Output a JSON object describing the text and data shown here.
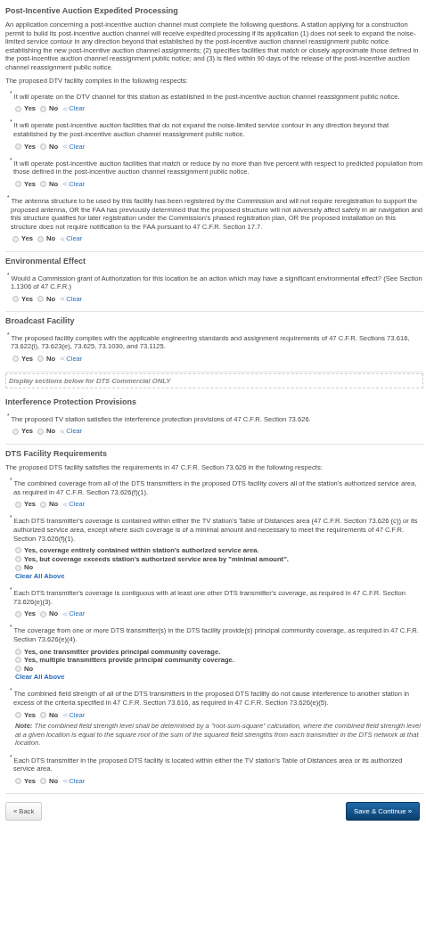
{
  "sections": [
    {
      "kind": "form",
      "title": "Post-Incentive Auction Expedited Processing",
      "blocks": [
        {
          "kind": "paragraph",
          "text": "An application concerning a post-incentive auction channel must complete the following questions. A station applying for a construction permit to build its post-incentive auction channel will receive expedited processing if its application (1) does not seek to expand the noise-limited service contour in any direction beyond that established by the post-incentive auction channel reassignment public notice establishing the new post-incentive auction channel assignments; (2) specifies facilities that match or closely approximate those defined in the post-incentive auction channel reassignment public notice; and (3) is filed within 90 days of the release of the post-incentive auction channel reassignment public notice."
        },
        {
          "kind": "group",
          "intro": "The proposed DTV facility complies in the following respects:",
          "questions": [
            {
              "text": "$^{*}$ It will operate on the DTV channel for this station as established in the post-incentive auction channel reassignment public notice.",
              "answer": {
                "kind": "yesno",
                "options": [
                  {
                    "label": "Yes",
                    "selected": false
                  },
                  {
                    "label": "No",
                    "selected": false
                  }
                ],
                "clear": "Clear"
              }
            },
            {
              "text": "$^{*}$ It will operate post-incentive auction facilities that do not expand the noise-limited service contour in any direction beyond that established by the post-incentive auction channel reassignment public notice.",
              "answer": {
                "kind": "yesno",
                "options": [
                  {
                    "label": "Yes",
                    "selected": false
                  },
                  {
                    "label": "No",
                    "selected": false
                  }
                ],
                "clear": "Clear"
              }
            },
            {
              "text": "$^{*}$ It will operate post-incentive auction facilities that match or reduce by no more than five percent with respect to predicted population from those defined in the post-incentive auction channel reassignment public notice.",
              "answer": {
                "kind": "yesno",
                "options": [
                  {
                    "label": "Yes",
                    "selected": false
                  },
                  {
                    "label": "No",
                    "selected": false
                  }
                ],
                "clear": "Clear"
              }
            }
          ]
        },
        {
          "kind": "question",
          "text": "$^{*}$ The antenna structure to be used by this facility has been registered by the Commission and will not require reregistration to support the proposed antenna, OR the FAA has previously determined that the proposed structure will not adversely affect safety in air navigation and this structure qualifies for later registration under the Commission's phased registration plan, OR the proposed installation on this structure does not require notification to the FAA pursuant to 47 C.F.R. Section 17.7.",
          "answer": {
            "kind": "yesno",
            "options": [
              {
                "label": "Yes",
                "selected": false
              },
              {
                "label": "No",
                "selected": false
              }
            ],
            "clear": "Clear"
          }
        }
      ]
    },
    {
      "kind": "form",
      "title": "Environmental Effect",
      "blocks": [
        {
          "kind": "question",
          "text": "$^{*}$ Would a Commission grant of Authorization for this location be an action which may have a significant environmental effect? (See Section 1.1306 of 47 C.F.R.)",
          "answer": {
            "kind": "yesno",
            "options": [
              {
                "label": "Yes",
                "selected": false
              },
              {
                "label": "No",
                "selected": false
              }
            ],
            "clear": "Clear"
          }
        }
      ]
    },
    {
      "kind": "form",
      "title": "Broadcast Facility",
      "blocks": [
        {
          "kind": "question",
          "text": "$^{*}$ The proposed facility complies with the applicable engineering standards and assignment requirements of 47 C.F.R. Sections 73.616, 73.622(i), 73.623(e), 73.625, 73.1030, and 73.1125.",
          "answer": {
            "kind": "yesno",
            "options": [
              {
                "label": "Yes",
                "selected": false
              },
              {
                "label": "No",
                "selected": false
              }
            ],
            "clear": "Clear"
          }
        }
      ]
    },
    {
      "kind": "notice",
      "text": "Display sections below for DTS Commercial ONLY"
    },
    {
      "kind": "form",
      "title": "Interference Protection Provisions",
      "blocks": [
        {
          "kind": "question",
          "text": "$^{*}$ The proposed TV station satisfies the interference protection provisions of 47 C.F.R. Section 73.626.",
          "answer": {
            "kind": "yesno",
            "options": [
              {
                "label": "Yes",
                "selected": false
              },
              {
                "label": "No",
                "selected": false
              }
            ],
            "clear": "Clear"
          }
        }
      ]
    },
    {
      "kind": "form",
      "title": "DTS Facility Requirements",
      "blocks": [
        {
          "kind": "group",
          "intro": "The proposed DTS facility satisfies the requirements in 47 C.F.R. Section 73.626 in the following respects:",
          "questions": [
            {
              "text": "$^{*}$ The combined coverage from all of the DTS transmitters in the proposed DTS facility covers all of the station's authorized service area, as required in 47 C.F.R. Section 73.626(f)(1).",
              "answer": {
                "kind": "yesno",
                "options": [
                  {
                    "label": "Yes",
                    "selected": false
                  },
                  {
                    "label": "No",
                    "selected": false
                  }
                ],
                "clear": "Clear"
              }
            },
            {
              "text": "$^{*}$ Each DTS transmitter's coverage is contained within either the TV station's Table of Distances area (47 C.F.R. Section 73.626 (c)) or its authorized service area, except where such coverage is of a minimal amount and necessary to meet the requirements of 47 C.F.R. Section 73.626(f)(1).",
              "answer": {
                "kind": "choice",
                "options": [
                  {
                    "label": "Yes, coverage entirely contained within station's authorized service area.",
                    "selected": false
                  },
                  {
                    "label": "Yes, but coverage exceeds station's authorized service area by \"minimal amount\".",
                    "selected": false
                  },
                  {
                    "label": "No",
                    "selected": false
                  }
                ],
                "clear": "Clear All Above"
              }
            },
            {
              "text": "$^{*}$ Each DTS transmitter's coverage is contiguous with at least one other DTS transmitter's coverage, as required in 47 C.F.R. Section 73.626(e)(3).",
              "answer": {
                "kind": "yesno",
                "options": [
                  {
                    "label": "Yes",
                    "selected": false
                  },
                  {
                    "label": "No",
                    "selected": false
                  }
                ],
                "clear": "Clear"
              }
            },
            {
              "text": "$^{*}$ The coverage from one or more DTS transmitter(s) in the DTS facility provide(s) principal community coverage, as required in 47 C.F.R. Section 73.626(e)(4).",
              "answer": {
                "kind": "choice",
                "options": [
                  {
                    "label": "Yes, one transmitter provides principal community coverage.",
                    "selected": false
                  },
                  {
                    "label": "Yes, multiple transmitters provide principal community coverage.",
                    "selected": false
                  },
                  {
                    "label": "No",
                    "selected": false
                  }
                ],
                "clear": "Clear All Above"
              }
            },
            {
              "text": "$^{*}$ The combined field strength of all of the DTS transmitters in the proposed DTS facility do not cause interference to another station in excess of the criteria specified in 47 C.F.R. Section 73.616, as required in 47 C.F.R. Section 73.626(e)(5).",
              "answer": {
                "kind": "yesno",
                "options": [
                  {
                    "label": "Yes",
                    "selected": false
                  },
                  {
                    "label": "No",
                    "selected": false
                  }
                ],
                "clear": "Clear"
              },
              "note": "**Note:** The combined field strength level shall be determined by a \"root-sum-square\" calculation, where the combined field strength level at a given location is equal to the square root of the sum of the squared field strengths from each transmitter in the DTS network at that location."
            },
            {
              "text": "$^{*}$ Each DTS transmitter in the proposed DTS facility is located within either the TV station's Table of Distances area or its authorized service area.",
              "answer": {
                "kind": "yesno",
                "options": [
                  {
                    "label": "Yes",
                    "selected": false
                  },
                  {
                    "label": "No",
                    "selected": false
                  }
                ],
                "clear": "Clear"
              }
            }
          ]
        }
      ]
    }
  ],
  "footer": {
    "back": "« Back",
    "next": "Save & Continue »"
  }
}
